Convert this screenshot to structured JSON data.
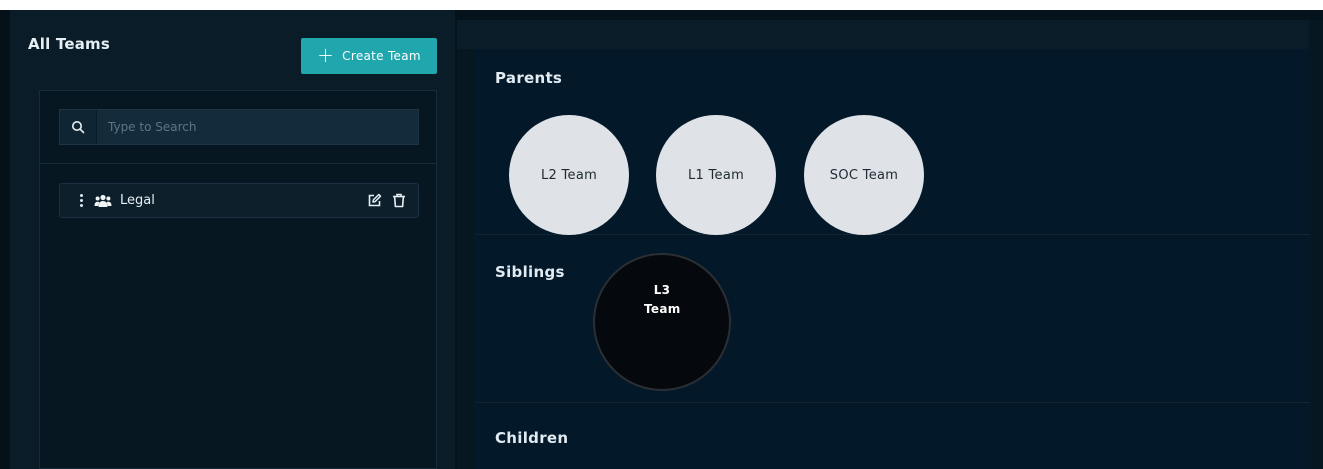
{
  "sidebar": {
    "title": "All Teams",
    "create_button_label": "Create Team",
    "search": {
      "placeholder": "Type to Search",
      "value": ""
    },
    "teams": [
      {
        "name": "Legal"
      }
    ]
  },
  "hierarchy": {
    "parents_title": "Parents",
    "parents": [
      "L2 Team",
      "L1 Team",
      "SOC Team"
    ],
    "siblings_title": "Siblings",
    "siblings": [
      "L3 Team"
    ],
    "children_title": "Children",
    "children": []
  },
  "colors": {
    "accent": "#1fa7ad",
    "background": "#03121b",
    "parent_bubble": "#dfe2e7",
    "current_bubble": "#05090d"
  },
  "icons": {
    "search": "search-icon",
    "plus": "plus-icon",
    "drag": "drag-handle-icon",
    "team": "users-icon",
    "edit": "edit-icon",
    "delete": "trash-icon"
  }
}
